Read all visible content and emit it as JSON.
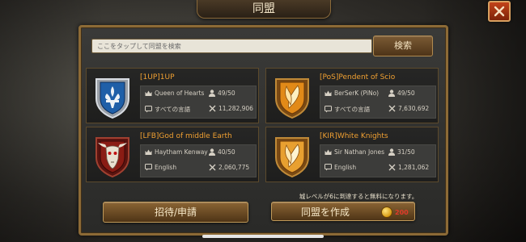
{
  "header": {
    "title": "同盟"
  },
  "search": {
    "placeholder": "ここをタップして同盟を検索",
    "button_label": "検索"
  },
  "alliances": [
    {
      "name": "[1UP]1UP",
      "leader": "Queen of Hearts",
      "members": "49/50",
      "language": "すべての言語",
      "power": "11,282,906",
      "emblem": "blue-fleur-de-lis-shield-emblem"
    },
    {
      "name": "[PoS]Pendent of Scio",
      "leader": "BerSerK (PiNo)",
      "members": "49/50",
      "language": "すべての言語",
      "power": "7,630,692",
      "emblem": "gold-feather-shield-emblem"
    },
    {
      "name": "[LFB]God of middle Earth",
      "leader": "Haytham Kenway",
      "members": "40/50",
      "language": "English",
      "power": "2,060,775",
      "emblem": "red-bull-skull-shield-emblem"
    },
    {
      "name": "[KIR]White Knights",
      "leader": "Sir Nathan Jones",
      "members": "31/50",
      "language": "English",
      "power": "1,281,062",
      "emblem": "gold-feather-shield-emblem"
    }
  ],
  "footer": {
    "note": "城レベルが6に到達すると無料になります。",
    "invite_label": "招待/申請",
    "create_label": "同盟を作成",
    "create_cost": "200"
  },
  "colors": {
    "name": "#f0a032",
    "frame": "#8c6a36",
    "cost": "#e03a2a"
  },
  "icons": [
    "close-icon",
    "crown-icon",
    "member-icon",
    "language-icon",
    "swords-icon",
    "gold-coin-icon"
  ]
}
